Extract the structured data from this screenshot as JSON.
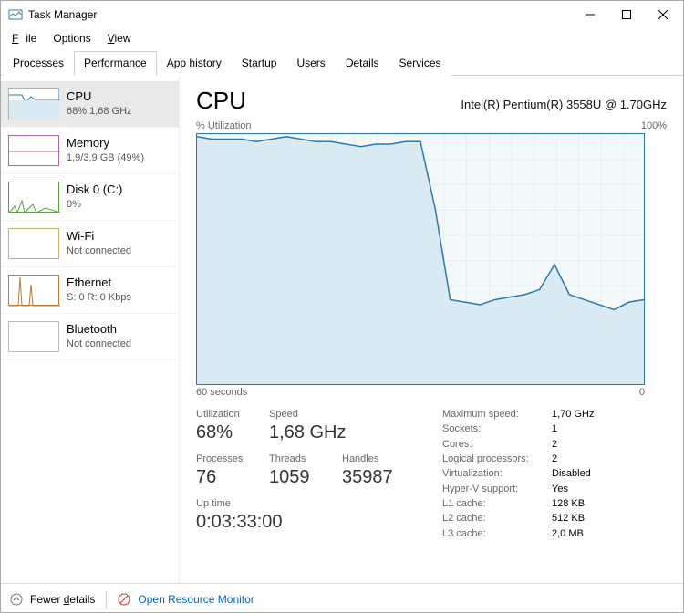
{
  "window": {
    "title": "Task Manager"
  },
  "menu": {
    "file": "File",
    "options": "Options",
    "view": "View"
  },
  "tabs": {
    "processes": "Processes",
    "performance": "Performance",
    "apphistory": "App history",
    "startup": "Startup",
    "users": "Users",
    "details": "Details",
    "services": "Services"
  },
  "sidebar": {
    "cpu": {
      "title": "CPU",
      "sub": "68%  1,68 GHz"
    },
    "memory": {
      "title": "Memory",
      "sub": "1,9/3,9 GB (49%)"
    },
    "disk": {
      "title": "Disk 0 (C:)",
      "sub": "0%"
    },
    "wifi": {
      "title": "Wi-Fi",
      "sub": "Not connected"
    },
    "ethernet": {
      "title": "Ethernet",
      "sub": "S: 0 R: 0 Kbps"
    },
    "bluetooth": {
      "title": "Bluetooth",
      "sub": "Not connected"
    }
  },
  "main": {
    "heading": "CPU",
    "model": "Intel(R) Pentium(R) 3558U @ 1.70GHz",
    "ylabel": "% Utilization",
    "ymax": "100%",
    "xlabel_left": "60 seconds",
    "xlabel_right": "0"
  },
  "stats": {
    "utilization_lbl": "Utilization",
    "utilization": "68%",
    "speed_lbl": "Speed",
    "speed": "1,68 GHz",
    "processes_lbl": "Processes",
    "processes": "76",
    "threads_lbl": "Threads",
    "threads": "1059",
    "handles_lbl": "Handles",
    "handles": "35987",
    "uptime_lbl": "Up time",
    "uptime": "0:03:33:00"
  },
  "details": {
    "maxspeed_lbl": "Maximum speed:",
    "maxspeed": "1,70 GHz",
    "sockets_lbl": "Sockets:",
    "sockets": "1",
    "cores_lbl": "Cores:",
    "cores": "2",
    "lprocs_lbl": "Logical processors:",
    "lprocs": "2",
    "virt_lbl": "Virtualization:",
    "virt": "Disabled",
    "hyperv_lbl": "Hyper-V support:",
    "hyperv": "Yes",
    "l1_lbl": "L1 cache:",
    "l1": "128 KB",
    "l2_lbl": "L2 cache:",
    "l2": "512 KB",
    "l3_lbl": "L3 cache:",
    "l3": "2,0 MB"
  },
  "footer": {
    "fewer": "Fewer details",
    "resource": "Open Resource Monitor"
  },
  "chart_data": {
    "type": "line",
    "title": "% Utilization",
    "xlabel": "seconds ago",
    "ylabel": "% Utilization",
    "xlim": [
      60,
      0
    ],
    "ylim": [
      0,
      100
    ],
    "x": [
      60,
      58,
      56,
      54,
      52,
      50,
      48,
      46,
      44,
      42,
      40,
      38,
      36,
      34,
      32,
      30,
      28,
      26,
      24,
      22,
      20,
      18,
      16,
      14,
      12,
      10,
      8,
      6,
      4,
      2,
      0
    ],
    "values": [
      99,
      98,
      98,
      98,
      97,
      98,
      99,
      98,
      97,
      97,
      96,
      95,
      96,
      96,
      97,
      97,
      70,
      34,
      33,
      32,
      34,
      35,
      36,
      38,
      48,
      36,
      34,
      32,
      30,
      33,
      34
    ]
  }
}
